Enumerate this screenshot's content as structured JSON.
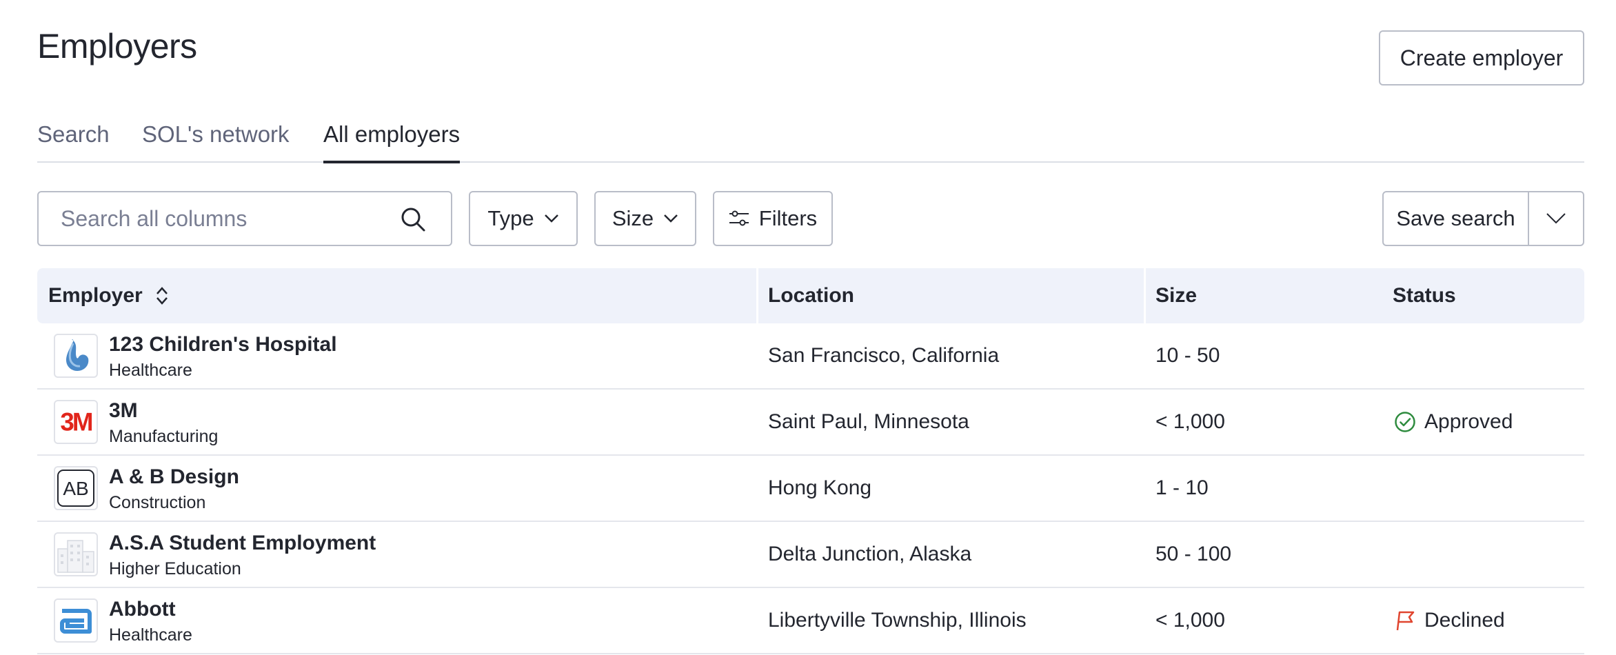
{
  "header": {
    "title": "Employers",
    "create_label": "Create employer"
  },
  "tabs": [
    {
      "label": "Search",
      "active": false
    },
    {
      "label": "SOL's network",
      "active": false
    },
    {
      "label": "All employers",
      "active": true
    }
  ],
  "toolbar": {
    "search_placeholder": "Search all columns",
    "type_label": "Type",
    "size_label": "Size",
    "filters_label": "Filters",
    "save_label": "Save search"
  },
  "table": {
    "columns": [
      "Employer",
      "Location",
      "Size",
      "Status"
    ],
    "rows": [
      {
        "name": "123 Children's Hospital",
        "type": "Healthcare",
        "location": "San Francisco, California",
        "size": "10 - 50",
        "status": "",
        "logo": "drop-logo-icon"
      },
      {
        "name": "3M",
        "type": "Manufacturing",
        "location": "Saint Paul, Minnesota",
        "size": "< 1,000",
        "status": "Approved",
        "logo": "3m-logo",
        "logo_text": "3M"
      },
      {
        "name": "A & B Design",
        "type": "Construction",
        "location": "Hong Kong",
        "size": "1 - 10",
        "status": "",
        "logo": "ab-logo",
        "logo_text": "AB"
      },
      {
        "name": "A.S.A Student Employment",
        "type": "Higher Education",
        "location": "Delta Junction, Alaska",
        "size": "50 - 100",
        "status": "",
        "logo": "building-placeholder-icon"
      },
      {
        "name": "Abbott",
        "type": "Healthcare",
        "location": "Libertyville Township, Illinois",
        "size": "< 1,000",
        "status": "Declined",
        "logo": "abbott-logo-icon"
      }
    ]
  },
  "colors": {
    "approved": "#2e8b3e",
    "declined": "#e0452f",
    "header_bg": "#eff2fa",
    "brand_3m": "#e1251b",
    "brand_abbott": "#3d8ed6",
    "drop_blue": "#4a89c8"
  }
}
